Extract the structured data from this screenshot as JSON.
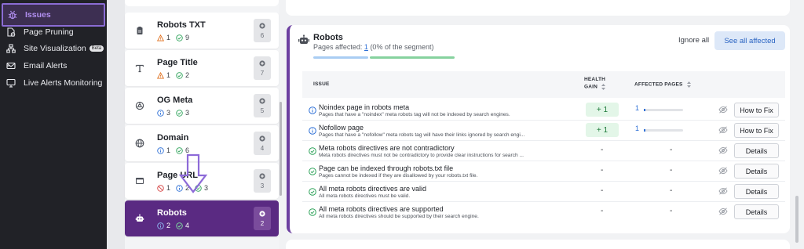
{
  "sidebar": {
    "items": [
      {
        "label": "Issues",
        "icon": "bug-icon",
        "active": true
      },
      {
        "label": "Page Pruning",
        "icon": "page-pruning-icon"
      },
      {
        "label": "Site Visualization",
        "icon": "sitemap-icon",
        "badge": "Beta"
      },
      {
        "label": "Email Alerts",
        "icon": "mail-icon"
      },
      {
        "label": "Live Alerts Monitoring",
        "icon": "monitor-icon"
      }
    ]
  },
  "segments": [
    {
      "name": "Robots TXT",
      "icon": "clipboard-icon",
      "c1": "1",
      "c2": "9",
      "count": "6"
    },
    {
      "name": "Page Title",
      "icon": "text-t-icon",
      "c1": "1",
      "c2": "2",
      "count": "7"
    },
    {
      "name": "OG Meta",
      "icon": "og-icon",
      "c1": "3",
      "c2": "3",
      "count": "5"
    },
    {
      "name": "Domain",
      "icon": "globe-icon",
      "c1": "1",
      "c2": "6",
      "count": "4"
    },
    {
      "name": "Page URL",
      "icon": "browser-icon",
      "c1": "1",
      "c2": "2",
      "c3": "3",
      "count": "3"
    },
    {
      "name": "Robots",
      "icon": "robot-icon",
      "c1": "2",
      "c2": "4",
      "count": "2"
    }
  ],
  "panel": {
    "title": "Robots",
    "pages_affected_label": "Pages affected:",
    "pages_affected_value": "1",
    "pages_affected_note": "(0% of the segment)",
    "ignore_all": "Ignore all",
    "see_all": "See all affected"
  },
  "table": {
    "headers": {
      "issue": "ISSUE",
      "health_gain_1": "HEALTH",
      "health_gain_2": "GAIN",
      "affected_pages": "AFFECTED PAGES"
    },
    "rows": [
      {
        "status": "info",
        "title": "Noindex page in robots meta",
        "desc": "Pages that have a \"noindex\" meta robots tag will not be indexed by search engines.",
        "gain": "+ 1",
        "affected": "1",
        "affected_pct": 0.04,
        "action": "How to Fix"
      },
      {
        "status": "info",
        "title": "Nofollow page",
        "desc": "Pages that have a \"nofollow\" meta robots tag will have their links ignored by search engi...",
        "gain": "+ 1",
        "affected": "1",
        "affected_pct": 0.04,
        "action": "How to Fix"
      },
      {
        "status": "ok",
        "title": "Meta robots directives are not contradictory",
        "desc": "Meta robots directives must not be contradictory to provide clear instructions for search ...",
        "gain": "-",
        "affected": "-",
        "action": "Details"
      },
      {
        "status": "ok",
        "title": "Page can be indexed through robots.txt file",
        "desc": "Pages cannot be indexed if they are disallowed by your robots.txt file.",
        "gain": "-",
        "affected": "-",
        "action": "Details"
      },
      {
        "status": "ok",
        "title": "All meta robots directives are valid",
        "desc": "All meta robots directives must be valid.",
        "gain": "-",
        "affected": "-",
        "action": "Details"
      },
      {
        "status": "ok",
        "title": "All meta robots directives are supported",
        "desc": "All meta robots directives should be supported by their search engine.",
        "gain": "-",
        "affected": "-",
        "action": "Details"
      }
    ]
  },
  "colors": {
    "accent": "#6c3fa0",
    "active_segment": "#5a2a82",
    "sidebar_bg": "#212227",
    "link": "#2d6fd6",
    "ok": "#2ea35a",
    "info": "#2d6fd6",
    "warning": "#e0701e",
    "error": "#d64545",
    "annotation_arrow": "#8d6ad8"
  }
}
